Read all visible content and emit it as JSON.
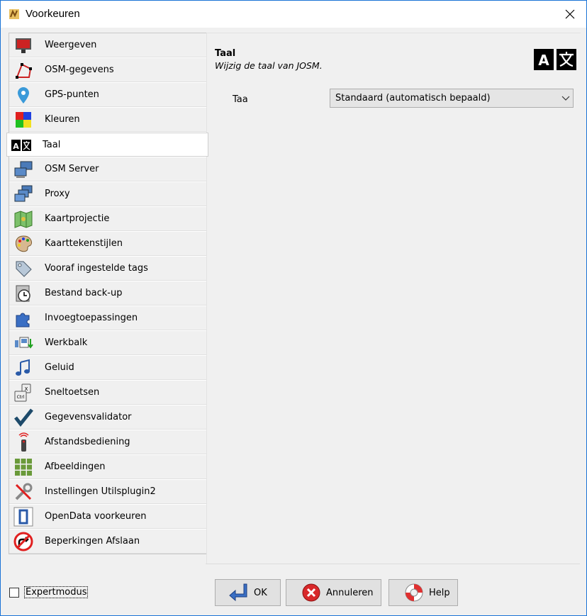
{
  "window": {
    "title": "Voorkeuren"
  },
  "sidebar": {
    "items": [
      {
        "label": "Weergeven",
        "icon": "display-icon"
      },
      {
        "label": "OSM-gegevens",
        "icon": "osm-data-icon"
      },
      {
        "label": "GPS-punten",
        "icon": "gps-pin-icon"
      },
      {
        "label": "Kleuren",
        "icon": "colors-icon"
      },
      {
        "label": "Taal",
        "icon": "language-icon"
      },
      {
        "label": "OSM Server",
        "icon": "server-icon"
      },
      {
        "label": "Proxy",
        "icon": "proxy-icon"
      },
      {
        "label": "Kaartprojectie",
        "icon": "map-projection-icon"
      },
      {
        "label": "Kaarttekenstijlen",
        "icon": "palette-icon"
      },
      {
        "label": "Vooraf ingestelde tags",
        "icon": "tag-icon"
      },
      {
        "label": "Bestand back-up",
        "icon": "clock-icon"
      },
      {
        "label": "Invoegtoepassingen",
        "icon": "plugin-icon"
      },
      {
        "label": "Werkbalk",
        "icon": "toolbar-icon"
      },
      {
        "label": "Geluid",
        "icon": "music-note-icon"
      },
      {
        "label": "Sneltoetsen",
        "icon": "keyboard-shortcut-icon"
      },
      {
        "label": "Gegevensvalidator",
        "icon": "checkmark-icon"
      },
      {
        "label": "Afstandsbediening",
        "icon": "remote-control-icon"
      },
      {
        "label": "Afbeeldingen",
        "icon": "imagery-grid-icon"
      },
      {
        "label": "Instellingen Utilsplugin2",
        "icon": "tools-icon"
      },
      {
        "label": "OpenData voorkeuren",
        "icon": "opendata-icon"
      },
      {
        "label": "Beperkingen Afslaan",
        "icon": "turn-restriction-icon"
      }
    ],
    "selected_index": 4
  },
  "panel": {
    "title": "Taal",
    "subtitle": "Wijzig de taal van JOSM.",
    "field_label": "Taa",
    "select_value": "Standaard (automatisch bepaald)"
  },
  "footer": {
    "expert_label": "Expertmodus",
    "ok_label": "OK",
    "cancel_label": "Annuleren",
    "help_label": "Help"
  },
  "colors": {
    "accent": "#1a73d6"
  }
}
